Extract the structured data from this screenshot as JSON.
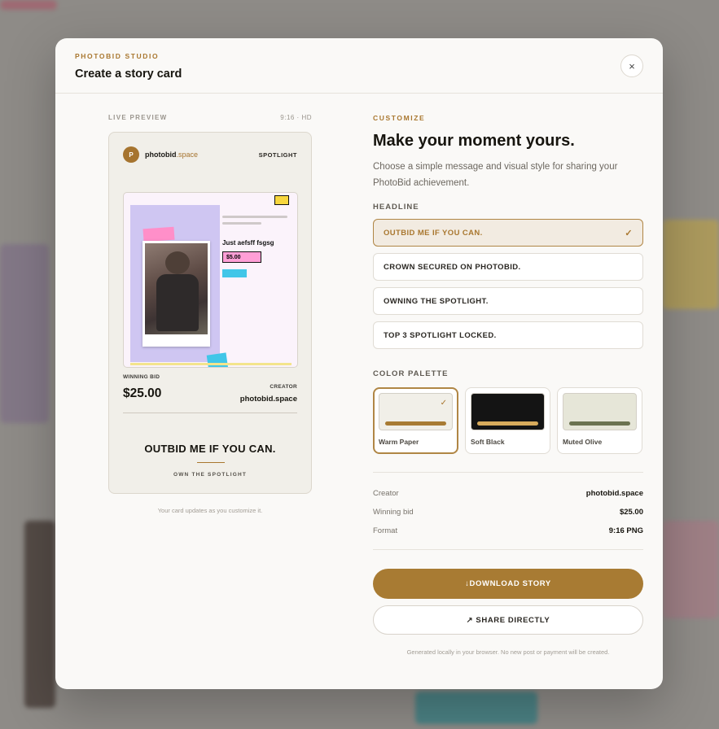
{
  "header": {
    "brand": "PHOTOBID STUDIO",
    "title": "Create a story card",
    "close_label": "×"
  },
  "preview": {
    "label": "LIVE PREVIEW",
    "format": "9:16 · HD",
    "logo_initial": "P",
    "logo_name": "photobid",
    "logo_tld": ".space",
    "badge": "SPOTLIGHT",
    "art_title": "Just aefsff fsgsg",
    "art_price": "$5.00",
    "winning_bid_label": "WINNING BID",
    "winning_bid_value": "$25.00",
    "creator_label": "CREATOR",
    "creator_value": "photobid.space",
    "headline": "OUTBID ME IF YOU CAN.",
    "subline": "OWN THE SPOTLIGHT",
    "note": "Your card updates as you customize it."
  },
  "customize": {
    "eyebrow": "CUSTOMIZE",
    "title": "Make your moment yours.",
    "description": "Choose a simple message and visual style for sharing your PhotoBid achievement.",
    "headline_label": "HEADLINE",
    "headlines": [
      {
        "label": "OUTBID ME IF YOU CAN.",
        "selected": true
      },
      {
        "label": "CROWN SECURED ON PHOTOBID.",
        "selected": false
      },
      {
        "label": "OWNING THE SPOTLIGHT.",
        "selected": false
      },
      {
        "label": "TOP 3 SPOTLIGHT LOCKED.",
        "selected": false
      }
    ],
    "palette_label": "COLOR PALETTE",
    "palettes": [
      {
        "name": "Warm Paper",
        "bg": "#f1efe8",
        "bar": "#a87b33",
        "selected": true
      },
      {
        "name": "Soft Black",
        "bg": "#141414",
        "bar": "#d8ab5c",
        "selected": false
      },
      {
        "name": "Muted Olive",
        "bg": "#e6e6d8",
        "bar": "#6b7350",
        "selected": false
      }
    ]
  },
  "details": {
    "creator_label": "Creator",
    "creator_value": "photobid.space",
    "bid_label": "Winning bid",
    "bid_value": "$25.00",
    "format_label": "Format",
    "format_value": "9:16 PNG"
  },
  "actions": {
    "download": "↓DOWNLOAD STORY",
    "share": "↗ SHARE DIRECTLY",
    "footer": "Generated locally in your browser. No new post or payment will be created."
  },
  "colors": {
    "accent": "#a87b33",
    "check_icon": "✓"
  }
}
